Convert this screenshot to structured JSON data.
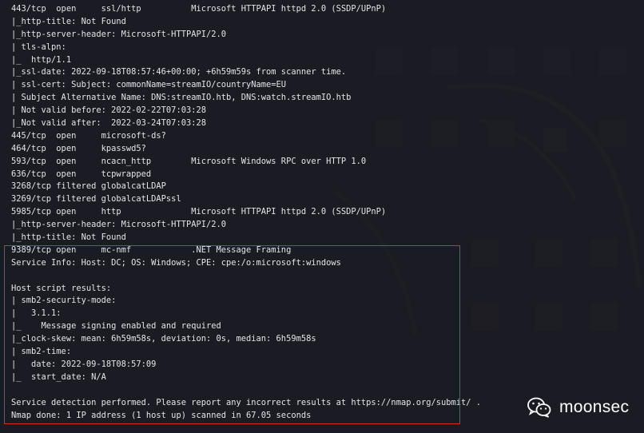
{
  "terminal": {
    "lines": [
      "443/tcp  open     ssl/http          Microsoft HTTPAPI httpd 2.0 (SSDP/UPnP)",
      "|_http-title: Not Found",
      "|_http-server-header: Microsoft-HTTPAPI/2.0",
      "| tls-alpn:",
      "|_  http/1.1",
      "|_ssl-date: 2022-09-18T08:57:46+00:00; +6h59m59s from scanner time.",
      "| ssl-cert: Subject: commonName=streamIO/countryName=EU",
      "| Subject Alternative Name: DNS:streamIO.htb, DNS:watch.streamIO.htb",
      "| Not valid before: 2022-02-22T07:03:28",
      "|_Not valid after:  2022-03-24T07:03:28",
      "445/tcp  open     microsoft-ds?",
      "464/tcp  open     kpasswd5?",
      "593/tcp  open     ncacn_http        Microsoft Windows RPC over HTTP 1.0",
      "636/tcp  open     tcpwrapped",
      "3268/tcp filtered globalcatLDAP",
      "3269/tcp filtered globalcatLDAPssl",
      "5985/tcp open     http              Microsoft HTTPAPI httpd 2.0 (SSDP/UPnP)",
      "|_http-server-header: Microsoft-HTTPAPI/2.0",
      "|_http-title: Not Found",
      "9389/tcp open     mc-nmf            .NET Message Framing",
      "Service Info: Host: DC; OS: Windows; CPE: cpe:/o:microsoft:windows",
      "",
      "Host script results:",
      "| smb2-security-mode:",
      "|   3.1.1:",
      "|_    Message signing enabled and required",
      "|_clock-skew: mean: 6h59m58s, deviation: 0s, median: 6h59m58s",
      "| smb2-time:",
      "|   date: 2022-09-18T08:57:09",
      "|_  start_date: N/A",
      "",
      "Service detection performed. Please report any incorrect results at https://nmap.org/submit/ .",
      "Nmap done: 1 IP address (1 host up) scanned in 67.05 seconds"
    ]
  },
  "watermark": {
    "icon": "wechat-icon",
    "text": "moonsec"
  },
  "colors": {
    "terminal_text": "#e3e5e8",
    "highlight_border": "#e0272b"
  }
}
